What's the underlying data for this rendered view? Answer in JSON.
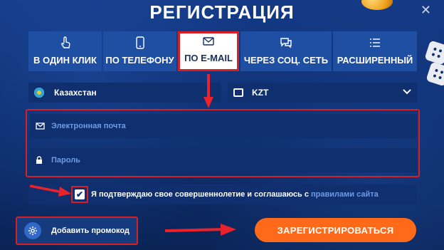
{
  "dialog": {
    "title": "РЕГИСТРАЦИЯ",
    "close_symbol": "✕"
  },
  "tabs": [
    {
      "label": "В ОДИН КЛИК",
      "icon": "pointer-hand-icon",
      "active": false
    },
    {
      "label": "ПО ТЕЛЕФОНУ",
      "icon": "phone-icon",
      "active": false
    },
    {
      "label": "ПО E-MAIL",
      "icon": "envelope-icon",
      "active": true
    },
    {
      "label": "ЧЕРЕЗ СОЦ. СЕТЬ",
      "icon": "chat-bubbles-icon",
      "active": false
    },
    {
      "label": "РАСШИРЕННЫЙ",
      "icon": "list-icon",
      "active": false
    }
  ],
  "country": {
    "value": "Казахстан",
    "icon": "kazakhstan-flag-icon"
  },
  "currency": {
    "value": "KZT",
    "icon": "currency-icon"
  },
  "fields": {
    "email_placeholder": "Электронная почта",
    "password_placeholder": "Пароль"
  },
  "agreement": {
    "checked": true,
    "text": "Я подтверждаю свое совершеннолетие и соглашаюсь с",
    "link": "правилами сайта"
  },
  "promo": {
    "label": "Добавить промокод",
    "icon": "gear-icon"
  },
  "register_button": {
    "label": "ЗАРЕГИСТРИРОВАТЬСЯ"
  },
  "colors": {
    "background": "#0d2d6d",
    "tab": "#1f4fa3",
    "field": "#0f2f6e",
    "accent_orange": "#ff6a1a",
    "highlight_red": "#d81f26",
    "link_blue": "#6f9be3"
  }
}
